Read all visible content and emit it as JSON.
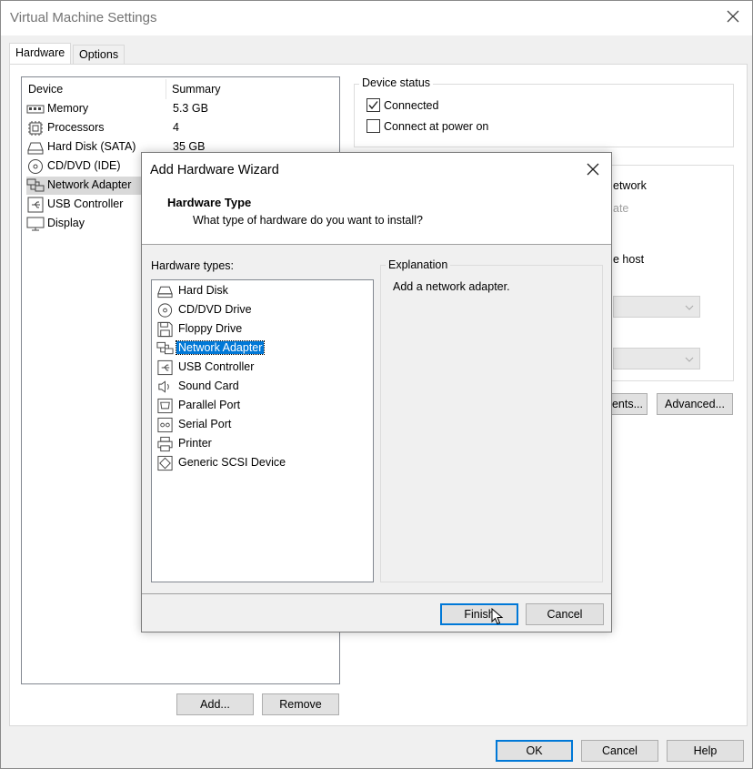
{
  "window": {
    "title": "Virtual Machine Settings",
    "tabs": [
      "Hardware",
      "Options"
    ],
    "active_tab": "Hardware"
  },
  "device_list": {
    "headers": {
      "device": "Device",
      "summary": "Summary"
    },
    "rows": [
      {
        "name": "Memory",
        "summary": "5.3 GB",
        "icon": "memory-icon"
      },
      {
        "name": "Processors",
        "summary": "4",
        "icon": "processor-icon"
      },
      {
        "name": "Hard Disk (SATA)",
        "summary": "35 GB",
        "icon": "hard-disk-icon"
      },
      {
        "name": "CD/DVD (IDE)",
        "summary": "",
        "icon": "cd-dvd-icon"
      },
      {
        "name": "Network Adapter",
        "summary": "",
        "icon": "network-adapter-icon"
      },
      {
        "name": "USB Controller",
        "summary": "",
        "icon": "usb-icon"
      },
      {
        "name": "Display",
        "summary": "",
        "icon": "display-icon"
      }
    ],
    "selected": "Network Adapter",
    "add_label": "Add...",
    "remove_label": "Remove"
  },
  "device_status": {
    "label": "Device status",
    "connected_label": "Connected",
    "connected_checked": true,
    "connect_power_label": "Connect at power on",
    "connect_power_checked": false
  },
  "network_connection": {
    "partial_network": "etwork",
    "partial_state": "ate",
    "partial_host": "e host",
    "segments_partial": "ents...",
    "advanced_label": "Advanced..."
  },
  "footer": {
    "ok_label": "OK",
    "cancel_label": "Cancel",
    "help_label": "Help"
  },
  "wizard": {
    "title": "Add Hardware Wizard",
    "heading": "Hardware Type",
    "subheading": "What type of hardware do you want to install?",
    "list_label": "Hardware types:",
    "items": [
      {
        "name": "Hard Disk",
        "icon": "hard-disk-icon"
      },
      {
        "name": "CD/DVD Drive",
        "icon": "cd-dvd-icon"
      },
      {
        "name": "Floppy Drive",
        "icon": "floppy-icon"
      },
      {
        "name": "Network Adapter",
        "icon": "network-adapter-icon"
      },
      {
        "name": "USB Controller",
        "icon": "usb-icon"
      },
      {
        "name": "Sound Card",
        "icon": "speaker-icon"
      },
      {
        "name": "Parallel Port",
        "icon": "parallel-port-icon"
      },
      {
        "name": "Serial Port",
        "icon": "serial-port-icon"
      },
      {
        "name": "Printer",
        "icon": "printer-icon"
      },
      {
        "name": "Generic SCSI Device",
        "icon": "scsi-icon"
      }
    ],
    "selected": "Network Adapter",
    "explanation_label": "Explanation",
    "explanation_text": "Add a network adapter.",
    "finish_label": "Finish",
    "cancel_label": "Cancel"
  },
  "colors": {
    "accent": "#0078d7",
    "selection_grey": "#d9d9d9"
  }
}
